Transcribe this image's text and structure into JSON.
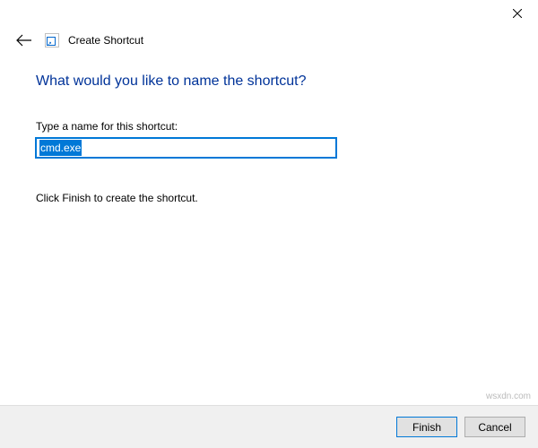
{
  "header": {
    "title": "Create Shortcut"
  },
  "main": {
    "heading": "What would you like to name the shortcut?",
    "name_label": "Type a name for this shortcut:",
    "name_value": "cmd.exe",
    "instruction": "Click Finish to create the shortcut."
  },
  "footer": {
    "finish_label": "Finish",
    "cancel_label": "Cancel"
  },
  "watermark": "wsxdn.com"
}
